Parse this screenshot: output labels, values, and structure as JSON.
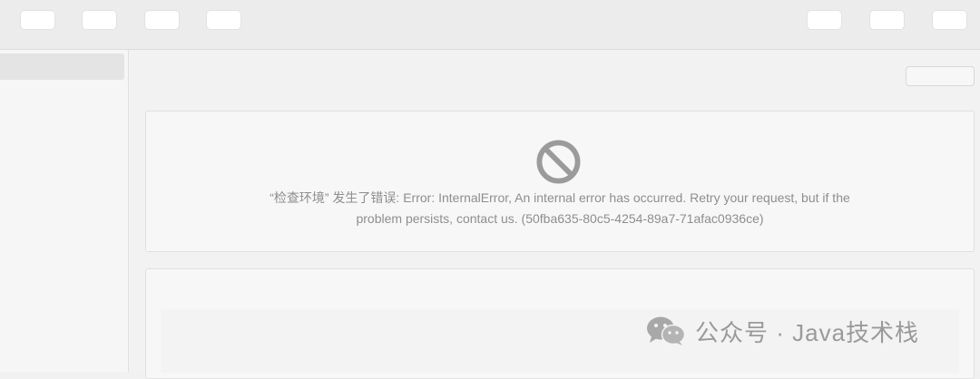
{
  "error": {
    "message": "“检查环境” 发生了错误: Error: InternalError, An internal error has occurred. Retry your request, but if the problem persists, contact us. (50fba635-80c5-4254-89a7-71afac0936ce)"
  },
  "watermark": {
    "text": "公众号 · Java技术栈",
    "logo_icon": "wechat-icon"
  },
  "icons": {
    "error": "prohibited-icon"
  },
  "colors": {
    "background": "#f1f1f1",
    "card": "#f7f7f7",
    "icon": "#9b9b9b",
    "text": "#8e8e8e"
  }
}
